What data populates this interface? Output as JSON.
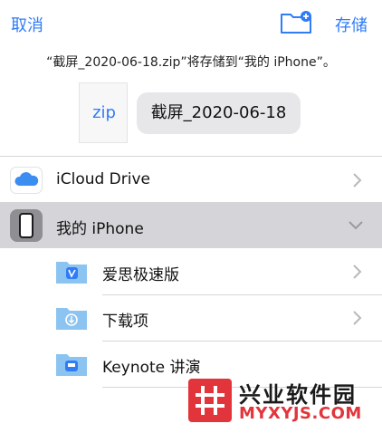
{
  "header": {
    "cancel_label": "取消",
    "save_label": "存储",
    "new_folder_icon": "folder-plus-icon"
  },
  "subtitle": "“截屏_2020-06-18.zip”将存储到“我的 iPhone”。",
  "file": {
    "thumb_text": "zip",
    "name": "截屏_2020-06-18"
  },
  "locations": [
    {
      "label": "iCloud Drive",
      "icon": "icloud-icon"
    },
    {
      "label": "我的 iPhone",
      "icon": "iphone-icon",
      "selected": true,
      "expanded": true
    }
  ],
  "folders": [
    {
      "label": "爱思极速版",
      "icon": "app-folder-icon"
    },
    {
      "label": "下载项",
      "icon": "download-folder-icon"
    },
    {
      "label": "Keynote 讲演",
      "icon": "keynote-folder-icon"
    }
  ],
  "watermark": {
    "title": "兴业软件园",
    "url": "MYXYJS.COM"
  },
  "colors": {
    "accent": "#2f7cf6",
    "selected_row": "#d5d5d9",
    "folder": "#8cc4f1",
    "watermark_red": "#e2353b"
  }
}
